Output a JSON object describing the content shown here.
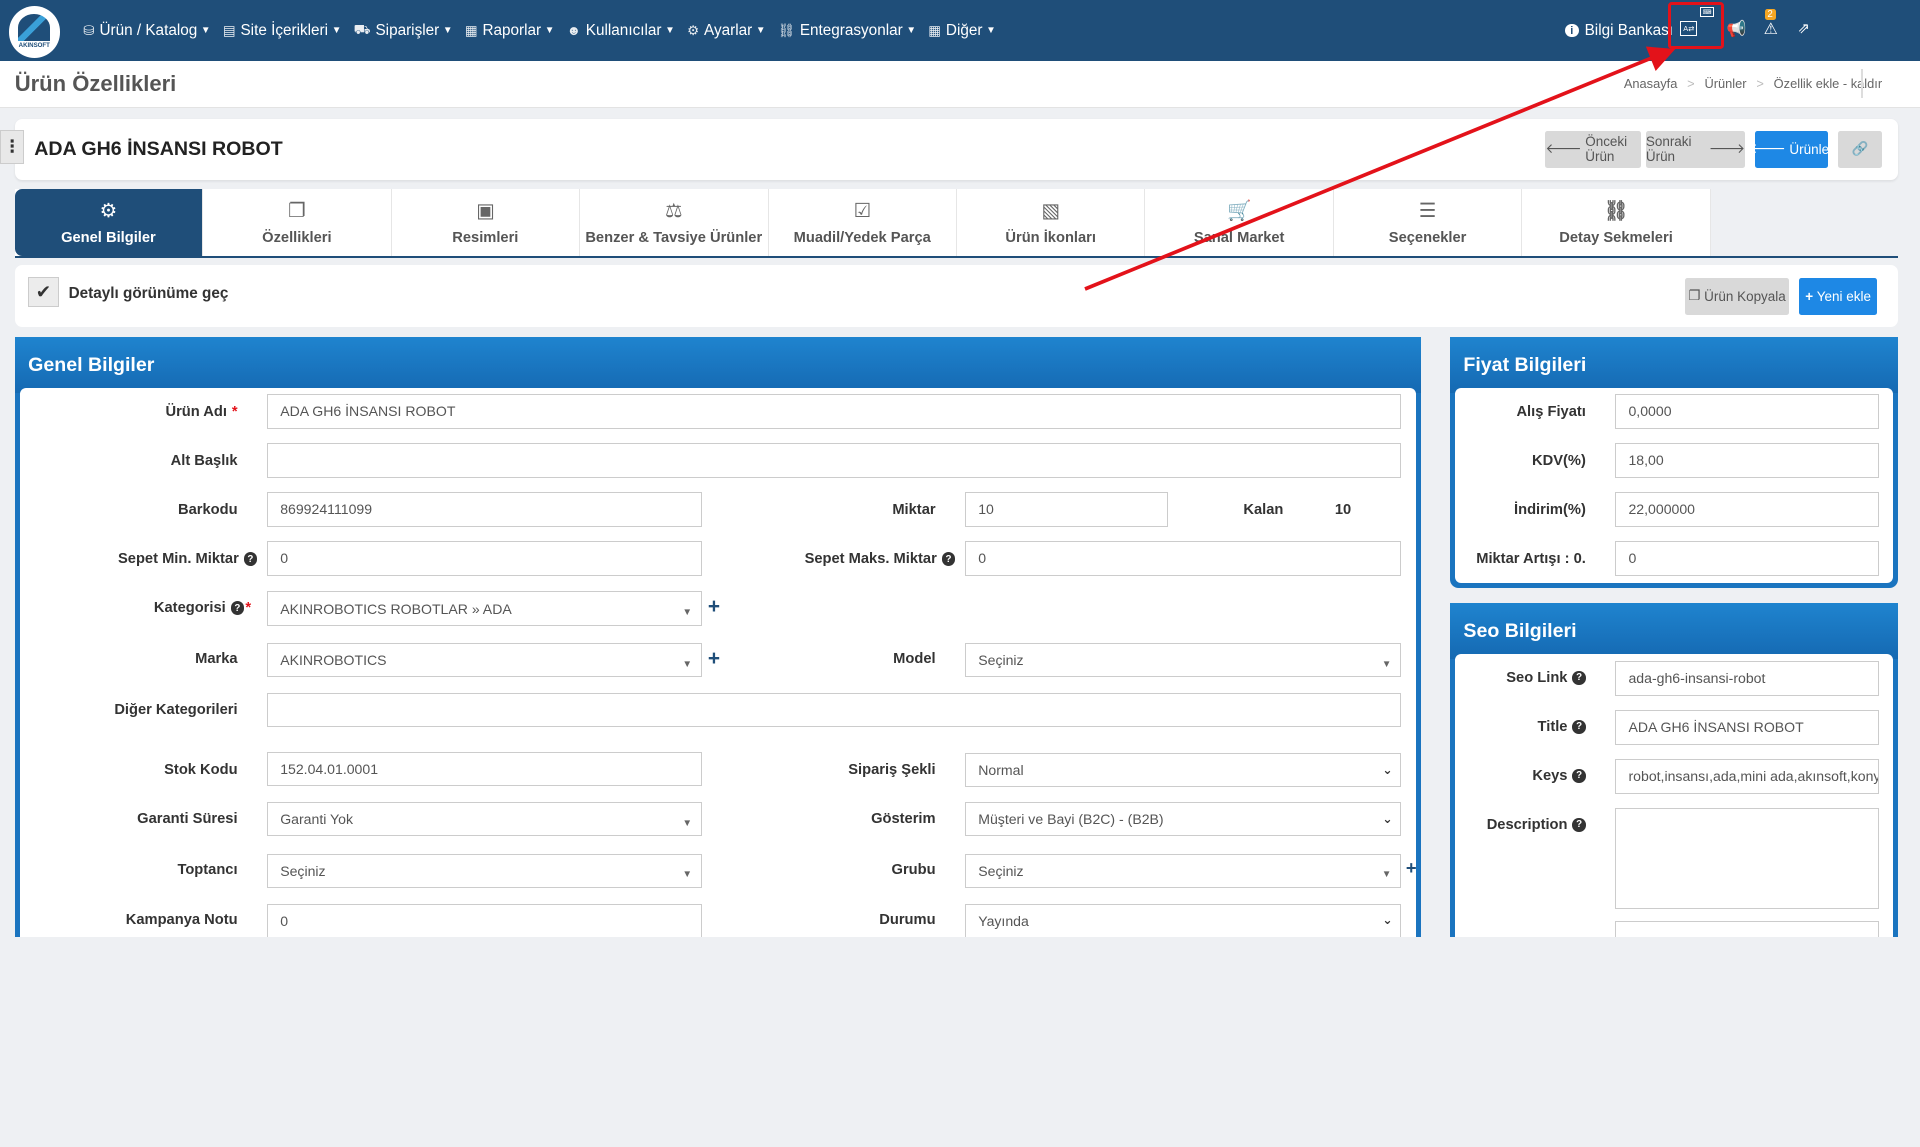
{
  "app": {
    "logo_text": "AKINSOFT"
  },
  "menu": [
    {
      "icon": "boxes-icon",
      "glyph": "⛁",
      "label": "Ürün / Katalog"
    },
    {
      "icon": "file-icon",
      "glyph": "▤",
      "label": "Site İçerikleri"
    },
    {
      "icon": "cart-icon",
      "glyph": "⛟",
      "label": "Siparişler"
    },
    {
      "icon": "report-icon",
      "glyph": "▦",
      "label": "Raporlar"
    },
    {
      "icon": "users-icon",
      "glyph": "☻",
      "label": "Kullanıcılar"
    },
    {
      "icon": "gears-icon",
      "glyph": "⚙",
      "label": "Ayarlar"
    },
    {
      "icon": "sitemap-icon",
      "glyph": "⛓",
      "label": "Entegrasyonlar"
    },
    {
      "icon": "grid-icon",
      "glyph": "▦",
      "label": "Diğer"
    }
  ],
  "topright": {
    "knowledge_base": "Bilgi Bankası",
    "alert_count": "2"
  },
  "page": {
    "title": "Ürün Özellikleri",
    "breadcrumb": [
      "Anasayfa",
      "Ürünler",
      "Özellik ekle - kaldır"
    ]
  },
  "product": {
    "name": "ADA GH6 İNSANSI ROBOT"
  },
  "buttons": {
    "prev": "Önceki Ürün",
    "next": "Sonraki Ürün",
    "products": "Ürünler",
    "copy": "Ürün Kopyala",
    "new": "Yeni ekle"
  },
  "tabs": [
    {
      "icon": "gears-icon",
      "glyph": "⚙",
      "label": "Genel Bilgiler"
    },
    {
      "icon": "copy-icon",
      "glyph": "❐",
      "label": "Özellikleri"
    },
    {
      "icon": "images-icon",
      "glyph": "▣",
      "label": "Resimleri"
    },
    {
      "icon": "balance-icon",
      "glyph": "⚖",
      "label": "Benzer & Tavsiye Ürünler"
    },
    {
      "icon": "check-square-icon",
      "glyph": "☑",
      "label": "Muadil/Yedek Parça"
    },
    {
      "icon": "file-image-icon",
      "glyph": "▧",
      "label": "Ürün İkonları"
    },
    {
      "icon": "cart-icon",
      "glyph": "🛒",
      "label": "Sanal Market"
    },
    {
      "icon": "list-icon",
      "glyph": "☰",
      "label": "Seçenekler"
    },
    {
      "icon": "sitemap-icon",
      "glyph": "⛓",
      "label": "Detay Sekmeleri"
    }
  ],
  "detail_toggle": "Detaylı görünüme geç",
  "general": {
    "title": "Genel Bilgiler",
    "urun_adi": {
      "label": "Ürün Adı",
      "value": "ADA GH6 İNSANSI ROBOT"
    },
    "alt_baslik": {
      "label": "Alt Başlık",
      "value": ""
    },
    "barkodu": {
      "label": "Barkodu",
      "value": "869924111099"
    },
    "miktar": {
      "label": "Miktar",
      "value": "10"
    },
    "kalan": {
      "label": "Kalan",
      "value": "10"
    },
    "sepet_min": {
      "label": "Sepet Min. Miktar",
      "value": "0"
    },
    "sepet_maks": {
      "label": "Sepet Maks. Miktar",
      "value": "0"
    },
    "kategorisi": {
      "label": "Kategorisi",
      "value": "AKINROBOTICS ROBOTLAR » ADA"
    },
    "marka": {
      "label": "Marka",
      "value": "AKINROBOTICS"
    },
    "model": {
      "label": "Model",
      "value": "Seçiniz"
    },
    "diger_kategoriler": {
      "label": "Diğer Kategorileri",
      "value": ""
    },
    "stok_kodu": {
      "label": "Stok Kodu",
      "value": "152.04.01.0001"
    },
    "siparis_sekli": {
      "label": "Sipariş Şekli",
      "value": "Normal"
    },
    "garanti": {
      "label": "Garanti Süresi",
      "value": "Garanti Yok"
    },
    "gosterim": {
      "label": "Gösterim",
      "value": "Müşteri ve Bayi (B2C) - (B2B)"
    },
    "toptanci": {
      "label": "Toptancı",
      "value": "Seçiniz"
    },
    "grubu": {
      "label": "Grubu",
      "value": "Seçiniz"
    },
    "kampanya": {
      "label": "Kampanya Notu",
      "value": "0"
    },
    "durumu": {
      "label": "Durumu",
      "value": "Yayında"
    }
  },
  "price": {
    "title": "Fiyat Bilgileri",
    "alis": {
      "label": "Alış Fiyatı",
      "value": "0,0000"
    },
    "kdv": {
      "label": "KDV(%)",
      "value": "18,00"
    },
    "indirim": {
      "label": "İndirim(%)",
      "value": "22,000000"
    },
    "artis": {
      "label": "Miktar Artışı : 0.",
      "value": "0"
    }
  },
  "seo": {
    "title": "Seo Bilgileri",
    "link": {
      "label": "Seo Link",
      "value": "ada-gh6-insansi-robot"
    },
    "title_field": {
      "label": "Title",
      "value": "ADA GH6 İNSANSI ROBOT"
    },
    "keys": {
      "label": "Keys",
      "value": "robot,insansı,ada,mini ada,akınsoft,konya"
    },
    "description": {
      "label": "Description",
      "value": ""
    }
  },
  "colors": {
    "navbar": "#1f4e79",
    "accent": "#1e88e5",
    "highlight": "#e3121a"
  }
}
